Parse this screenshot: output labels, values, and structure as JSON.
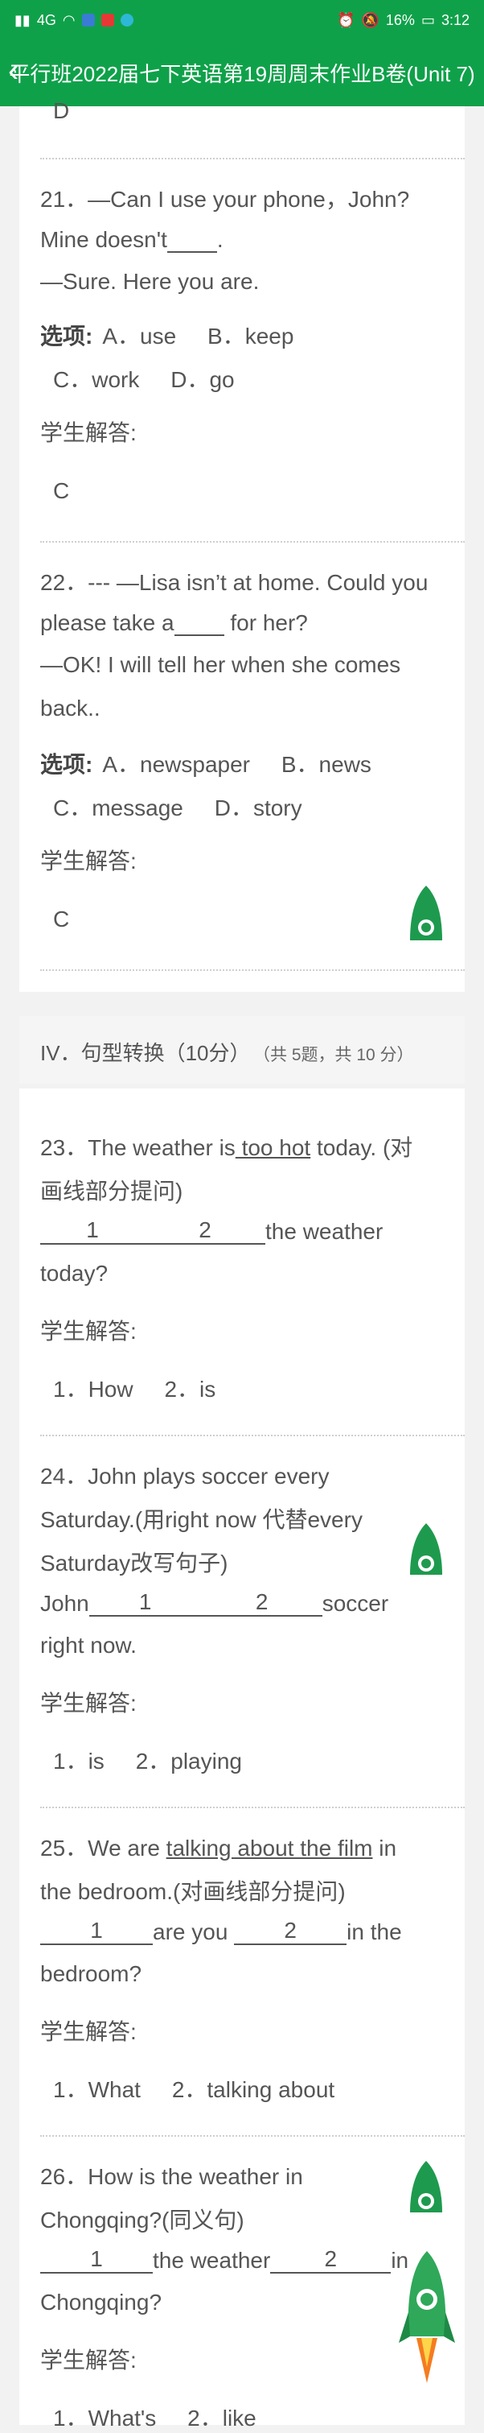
{
  "status": {
    "network": "4G",
    "battery": "16%",
    "time": "3:12"
  },
  "header": {
    "title": "平行班2022届七下英语第19周周末作业B卷(Unit 7)"
  },
  "prev_answer": "D",
  "labels": {
    "options": "选项:",
    "student_answer": "学生解答:"
  },
  "questions": [
    {
      "line1": "21．—Can I use your phone，John?",
      "line2_a": "Mine doesn't",
      "line2_blank": "____",
      "line2_b": ".",
      "line3": "—Sure. Here you are.",
      "opts_a": "A．use     B．keep",
      "opts_b": "C．work     D．go",
      "answer": "C"
    },
    {
      "line1": "22．--- —Lisa isn’t at home. Could you",
      "line2_a": "please take a",
      "line2_blank": "____",
      "line2_b": " for her?",
      "line3": "—OK! I will tell her when she comes",
      "line4": "back..",
      "opts_a": "A．newspaper     B．news",
      "opts_b": "C．message     D．story",
      "answer": "C"
    }
  ],
  "section": {
    "title": "IV．句型转换（10分）",
    "meta": "（共 5题，共 10 分）"
  },
  "q23": {
    "l1_a": "23．The weather is",
    "l1_u": " too hot",
    "l1_b": " today. (对",
    "l2": "画线部分提问)",
    "b1": "1",
    "b2": "2",
    "l3_b": "the weather",
    "l4": "today?",
    "answer": "1．How     2．is"
  },
  "q24": {
    "l1": "24．John plays soccer every",
    "l2": "Saturday.(用right now 代替every",
    "l3": "Saturday改写句子)",
    "l4_a": "John",
    "b1": "1",
    "b2": "2",
    "l4_b": "soccer",
    "l5": "right now.",
    "answer": "1．is     2．playing"
  },
  "q25": {
    "l1_a": "25．We are ",
    "l1_u": "talking about the film",
    "l1_b": " in",
    "l2": "the bedroom.(对画线部分提问)",
    "b1": "1",
    "l3_m": "are you ",
    "b2": "2",
    "l3_b": "in the",
    "l4": "bedroom?",
    "answer": "1．What     2．talking about"
  },
  "q26": {
    "l1": "26．How is the weather in",
    "l2": "Chongqing?(同义句)",
    "b1": "1",
    "l3_m": "the weather",
    "b2": "2",
    "l3_b": "in",
    "l4": "Chongqing?",
    "answer": "1．What's     2．like"
  }
}
